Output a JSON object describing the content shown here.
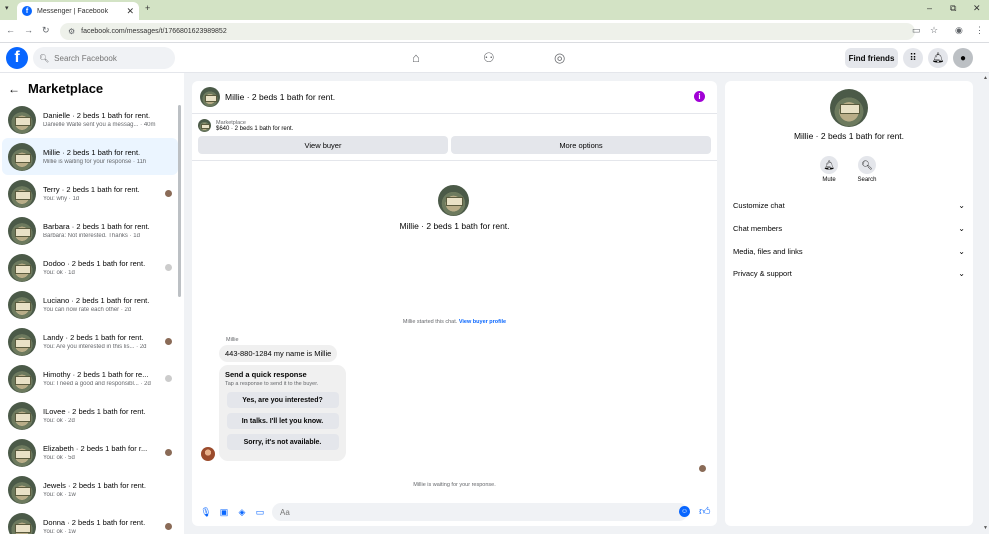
{
  "browser": {
    "tab_title": "Messenger | Facebook",
    "tab_close": "✕",
    "new_tab": "+",
    "url": "facebook.com/messages/t/1766801623989852",
    "win_min": "–",
    "win_max": "⧉",
    "win_close": "✕"
  },
  "fb": {
    "logo": "f",
    "search_placeholder": "Search Facebook",
    "find_friends": "Find friends"
  },
  "sidebar": {
    "title": "Marketplace",
    "conversations": [
      {
        "name": "Danielle · 2 beds 1 bath for rent.",
        "sub": "Danielle Waite sent you a messag... · 40m"
      },
      {
        "name": "Millie · 2 beds 1 bath for rent.",
        "sub": "Millie is waiting for your response · 11h"
      },
      {
        "name": "Terry · 2 beds 1 bath for rent.",
        "sub": "You: why · 1d"
      },
      {
        "name": "Barbara · 2 beds 1 bath for rent.",
        "sub": "Barbara: Not interested. Thanks · 1d"
      },
      {
        "name": "Dodoo · 2 beds 1 bath for rent.",
        "sub": "You: ok · 1d"
      },
      {
        "name": "Luciano · 2 beds 1 bath for rent.",
        "sub": "You can now rate each other · 2d"
      },
      {
        "name": "Landy · 2 beds 1 bath for rent.",
        "sub": "You: Are you interested in this lis... · 2d"
      },
      {
        "name": "Himothy · 2 beds 1 bath for re...",
        "sub": "You: I need a good and responsibl... · 2d"
      },
      {
        "name": "ILovee · 2 beds 1 bath for rent.",
        "sub": "You: ok · 2d"
      },
      {
        "name": "Elizabeth · 2 beds 1 bath for r...",
        "sub": "You: ok · 5d"
      },
      {
        "name": "Jewels · 2 beds 1 bath for rent.",
        "sub": "You: ok · 1w"
      },
      {
        "name": "Donna · 2 beds 1 bath for rent.",
        "sub": "You: ok · 1w"
      }
    ]
  },
  "chat": {
    "title": "Millie · 2 beds 1 bath for rent.",
    "marketplace_label": "Marketplace",
    "listing": "$640 · 2 beds 1 bath for rent.",
    "view_buyer": "View buyer",
    "more_options": "More options",
    "started_text": "Millie started this chat.",
    "view_buyer_profile": "View buyer profile",
    "sender": "Millie",
    "message": "443-880-1284  my name is Millie",
    "quick_title": "Send a quick response",
    "quick_sub": "Tap a response to send it to the buyer.",
    "quick_options": [
      "Yes, are you interested?",
      "In talks. I'll let you know.",
      "Sorry, it's not available."
    ],
    "waiting": "Millie is waiting for your response.",
    "composer_placeholder": "Aa"
  },
  "info": {
    "name": "Millie · 2 beds 1 bath for rent.",
    "mute": "Mute",
    "search": "Search",
    "sections": [
      "Customize chat",
      "Chat members",
      "Media, files and links",
      "Privacy & support"
    ]
  }
}
